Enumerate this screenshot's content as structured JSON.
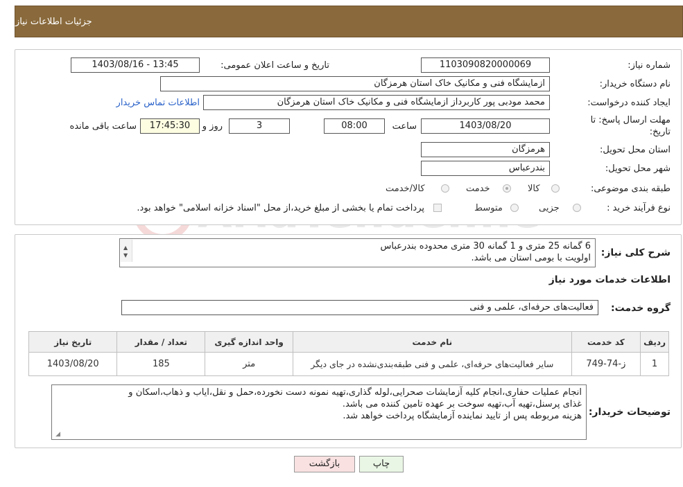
{
  "header": {
    "title": "جزئیات اطلاعات نیاز"
  },
  "fields": {
    "need_number_label": "شماره نیاز:",
    "need_number": "1103090820000069",
    "announce_label": "تاریخ و ساعت اعلان عمومی:",
    "announce_value": "1403/08/16 - 13:45",
    "buyer_org_label": "نام دستگاه خریدار:",
    "buyer_org": "ازمایشگاه فنی و مکانیک خاک استان هرمزگان",
    "requester_label": "ایجاد کننده درخواست:",
    "requester": "محمد  مودبی پور کاربرداز ازمایشگاه فنی و مکانیک خاک استان هرمزگان",
    "contact_link": "اطلاعات تماس خریدار",
    "deadline_label_1": "مهلت ارسال پاسخ: تا",
    "deadline_label_2": "تاریخ:",
    "deadline_date": "1403/08/20",
    "time_label": "ساعت",
    "deadline_time": "08:00",
    "days_value": "3",
    "days_label": "روز و",
    "remaining_time": "17:45:30",
    "remaining_label": "ساعت باقی مانده",
    "province_label": "استان محل تحویل:",
    "province": "هرمزگان",
    "city_label": "شهر محل تحویل:",
    "city": "بندرعباس",
    "category_label": "طبقه بندی موضوعی:",
    "category_options": [
      "کالا",
      "خدمت",
      "کالا/خدمت"
    ],
    "category_selected": "خدمت",
    "process_label": "نوع فرآیند خرید :",
    "process_options": [
      "جزیی",
      "متوسط"
    ],
    "payment_note": "پرداخت تمام یا بخشی از مبلغ خرید،از محل \"اسناد خزانه اسلامی\" خواهد بود."
  },
  "description": {
    "label": "شرح کلی نیاز:",
    "lines": [
      "6 گمانه 25 متری و 1 گمانه 30 متری محدوده بندرعباس",
      "اولویت با بومی استان می باشد."
    ]
  },
  "services": {
    "section_title": "اطلاعات خدمات مورد نیاز",
    "group_label": "گروه خدمت:",
    "group_value": "فعالیت‌های حرفه‌ای، علمی و فنی",
    "table": {
      "headers": [
        "ردیف",
        "کد خدمت",
        "نام خدمت",
        "واحد اندازه گیری",
        "تعداد / مقدار",
        "تاریخ نیاز"
      ],
      "rows": [
        [
          "1",
          "ز-74-749",
          "سایر فعالیت‌های حرفه‌ای، علمی و فنی طبقه‌بندی‌نشده در جای دیگر",
          "متر",
          "185",
          "1403/08/20"
        ]
      ]
    }
  },
  "buyer_notes": {
    "label": "توضیحات خریدار:",
    "lines": [
      "انجام عملیات حفاری،انجام کلیه آزمایشات صحرایی،لوله گذاری،تهیه نمونه دست نخورده،حمل و نقل،ایاب و ذهاب،اسکان و",
      "غذای پرسنل،تهیه آب،تهیه سوخت بر عهده تامین کننده می باشد.",
      "هزینه مربوطه پس از تایید نماینده آزمایشگاه پرداخت خواهد شد."
    ]
  },
  "buttons": {
    "print": "چاپ",
    "back": "بازگشت"
  },
  "watermark": {
    "text": "AriaTender.neT"
  },
  "colors": {
    "header_bg": "#8a6a3c",
    "link": "#2a62c9",
    "print_btn": "#e9f6e5",
    "back_btn": "#f9e1e1"
  }
}
